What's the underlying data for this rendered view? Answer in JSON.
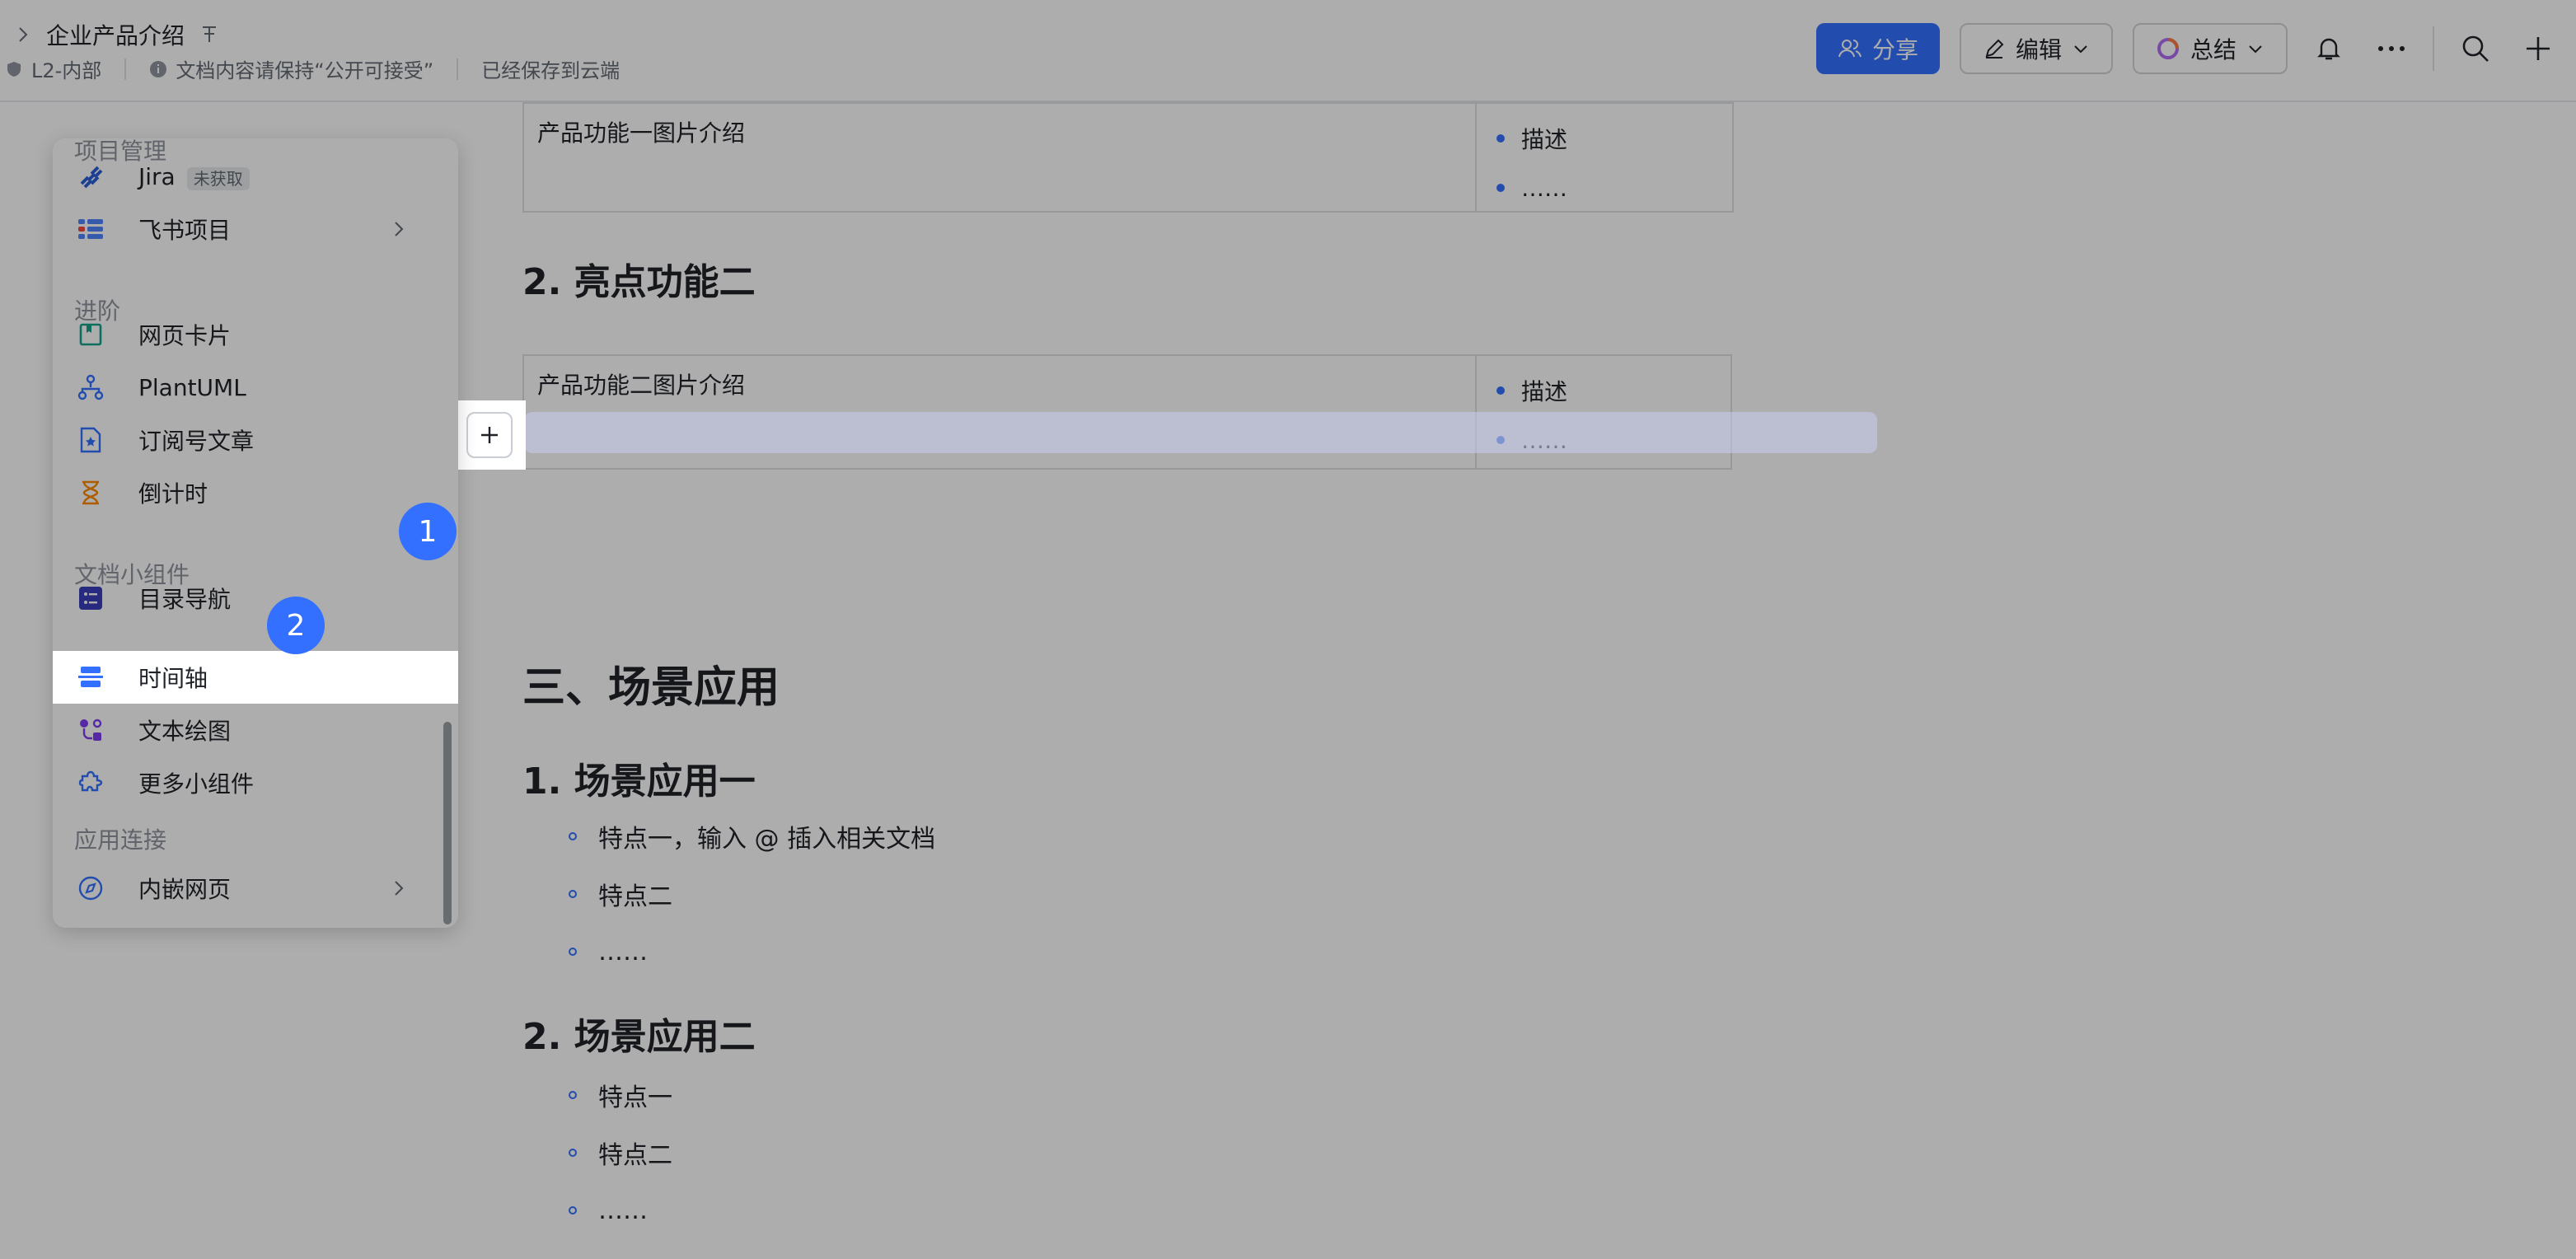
{
  "topbar": {
    "doc_title": "企业产品介绍",
    "permission": "L2-内部",
    "notice": "文档内容请保持“公开可接受”",
    "save_status": "已经保存到云端",
    "share_label": "分享",
    "edit_label": "编辑",
    "summary_label": "总结"
  },
  "doc": {
    "table1": {
      "left": "产品功能一图片介绍",
      "bullets": [
        "描述",
        "……"
      ]
    },
    "h_feature2": "2. 亮点功能二",
    "table2": {
      "left": "产品功能二图片介绍",
      "bullets": [
        "描述",
        "……"
      ]
    },
    "section3": "三、场景应用",
    "scene1": "1. 场景应用一",
    "scene1_items": [
      "特点一，输入 @ 插入相关文档",
      "特点二",
      "……"
    ],
    "scene2": "2. 场景应用二",
    "scene2_items": [
      "特点一",
      "特点二",
      "……"
    ]
  },
  "menu": {
    "sec_project": "项目管理",
    "jira": "Jira",
    "jira_badge": "未获取",
    "feishu_project": "飞书项目",
    "sec_advanced": "进阶",
    "webcard": "网页卡片",
    "plantuml": "PlantUML",
    "subscription": "订阅号文章",
    "countdown": "倒计时",
    "sec_widgets": "文档小组件",
    "toc": "目录导航",
    "timeline": "时间轴",
    "text_drawing": "文本绘图",
    "more_widgets": "更多小组件",
    "sec_apps": "应用连接",
    "embed_web": "内嵌网页"
  },
  "steps": {
    "one": "1",
    "two": "2"
  },
  "colors": {
    "accent": "#3370ff",
    "text": "#1f2329",
    "muted": "#8f959e"
  }
}
